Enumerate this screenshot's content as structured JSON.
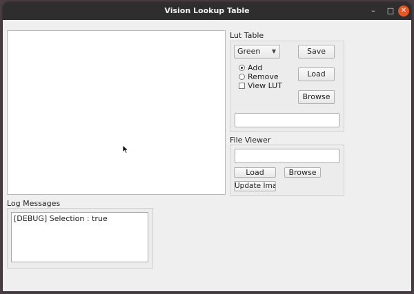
{
  "window": {
    "title": "Vision Lookup Table",
    "minimize": "–",
    "maximize": "□",
    "close": "✕"
  },
  "lut": {
    "heading": "Lut Table",
    "color_select": "Green",
    "save_label": "Save",
    "load_label": "Load",
    "browse_label": "Browse",
    "add_label": "Add",
    "remove_label": "Remove",
    "view_lut_label": "View LUT",
    "path_value": ""
  },
  "file_viewer": {
    "heading": "File Viewer",
    "path_value": "",
    "load_label": "Load",
    "browse_label": "Browse",
    "update_label": "Update Image"
  },
  "log": {
    "heading": "Log Messages",
    "lines": [
      "[DEBUG] Selection : true"
    ]
  }
}
